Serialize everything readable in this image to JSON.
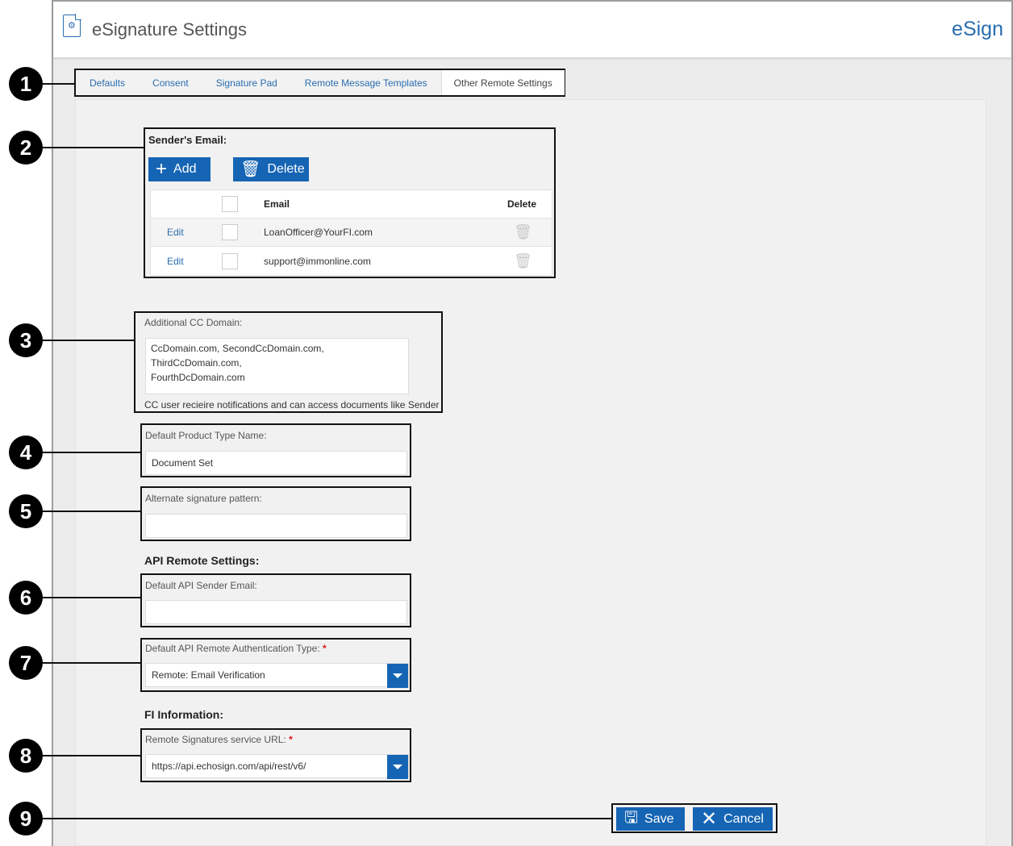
{
  "header": {
    "title": "eSignature Settings",
    "brand": "eSign",
    "icon": "settings-document-icon"
  },
  "tabs": [
    {
      "label": "Defaults",
      "active": false
    },
    {
      "label": "Consent",
      "active": false
    },
    {
      "label": "Signature Pad",
      "active": false
    },
    {
      "label": "Remote Message Templates",
      "active": false
    },
    {
      "label": "Other Remote Settings",
      "active": true
    }
  ],
  "callouts": [
    "1",
    "2",
    "3",
    "4",
    "5",
    "6",
    "7",
    "8",
    "9"
  ],
  "sender_email": {
    "label": "Sender's Email:",
    "add_label": "Add",
    "delete_label": "Delete",
    "columns": {
      "email": "Email",
      "delete": "Delete"
    },
    "rows": [
      {
        "edit": "Edit",
        "email": "LoanOfficer@YourFI.com"
      },
      {
        "edit": "Edit",
        "email": "support@immonline.com"
      }
    ]
  },
  "cc_domain": {
    "label": "Additional CC Domain:",
    "lines": [
      "CcDomain.com, SecondCcDomain.com,",
      "ThirdCcDomain.com,",
      "FourthDcDomain.com"
    ],
    "hint": "CC user recieire notifications and can access documents like Sender"
  },
  "product_type": {
    "label": "Default Product Type Name:",
    "value": "Document Set"
  },
  "alt_signature": {
    "label": "Alternate signature pattern:",
    "value": ""
  },
  "api_remote": {
    "heading": "API Remote Settings:",
    "sender_email_label": "Default API Sender Email:",
    "sender_email_value": "",
    "auth_type_label": "Default API Remote Authentication Type:",
    "auth_type_value": "Remote: Email Verification",
    "required_mark": "*"
  },
  "fi_info": {
    "heading": "FI Information:",
    "url_label": "Remote Signatures service URL:",
    "url_value": "https://api.echosign.com/api/rest/v6/",
    "required_mark": "*"
  },
  "actions": {
    "save_label": "Save",
    "cancel_label": "Cancel"
  },
  "colors": {
    "accent": "#1565b4",
    "link": "#2a6db0",
    "required": "#dd1111"
  }
}
